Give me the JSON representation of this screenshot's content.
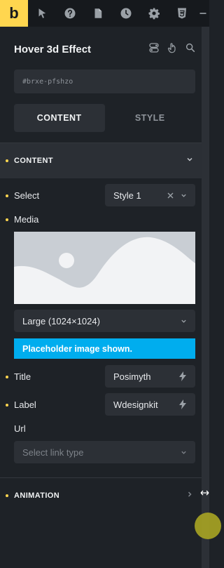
{
  "topbar": {
    "logo": "b",
    "icons": [
      "pointer-icon",
      "help-icon",
      "page-icon",
      "history-icon",
      "settings-icon",
      "css3-icon",
      "minus-icon"
    ]
  },
  "header": {
    "title": "Hover 3d Effect"
  },
  "element_id": "#brxe-pfshzo",
  "tabs": {
    "content": "CONTENT",
    "style": "STYLE"
  },
  "sections": {
    "content": "CONTENT",
    "animation": "ANIMATION"
  },
  "fields": {
    "select": {
      "label": "Select",
      "value": "Style 1"
    },
    "media": {
      "label": "Media",
      "size": "Large (1024×1024)",
      "notice": "Placeholder image shown."
    },
    "title": {
      "label": "Title",
      "value": "Posimyth"
    },
    "label": {
      "label": "Label",
      "value": "Wdesignkit"
    },
    "url": {
      "label": "Url",
      "placeholder": "Select link type"
    }
  },
  "colors": {
    "accent": "#ffd64f",
    "info": "#00adee",
    "bg": "#1e2227",
    "control": "#2c3036"
  }
}
